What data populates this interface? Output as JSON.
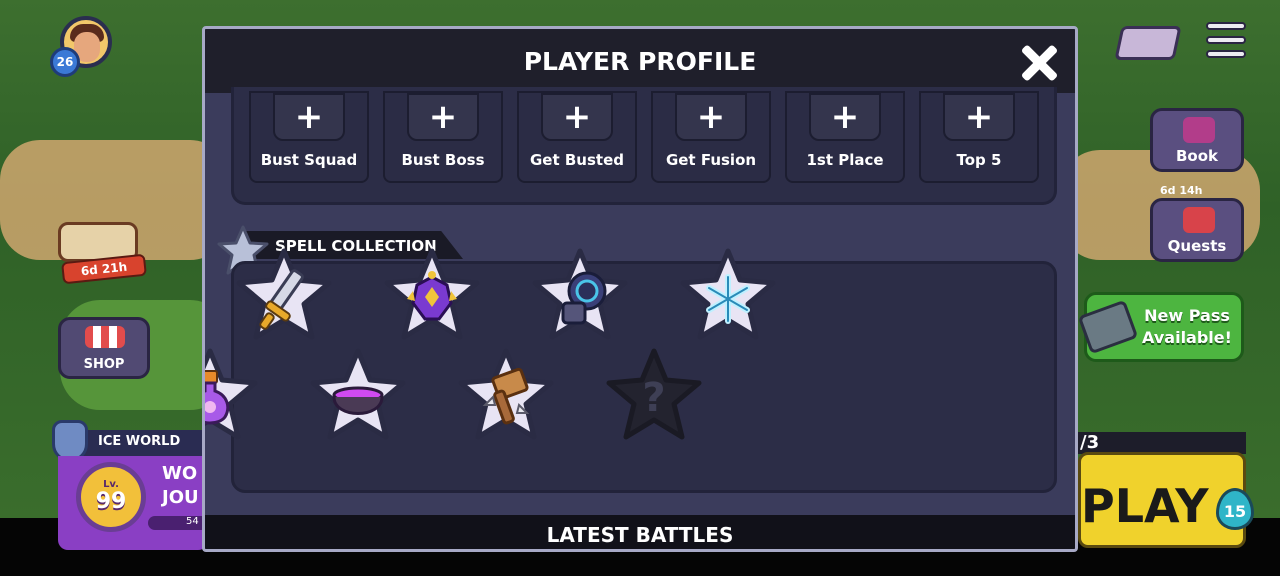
{
  "hud": {
    "player_level": "26",
    "event_timer": "6d 21h",
    "shop_label": "SHOP",
    "world_name": "ICE WORLD",
    "world_level_prefix": "Lv.",
    "world_level": "99",
    "world_title_line1": "WO",
    "world_title_line2": "JOU",
    "world_xp_text": "54",
    "book_label": "Book",
    "quests_timer": "6d 14h",
    "quests_label": "Quests",
    "pass_label": "New Pass Available!",
    "play_progress": "/3",
    "play_label": "PLAY",
    "energy_count": "15"
  },
  "modal": {
    "title": "PLAYER PROFILE",
    "achievements": [
      {
        "label": "Bust Squad",
        "icon": "plus-icon"
      },
      {
        "label": "Bust Boss",
        "icon": "plus-icon"
      },
      {
        "label": "Get Busted",
        "icon": "plus-icon"
      },
      {
        "label": "Get Fusion",
        "icon": "plus-icon"
      },
      {
        "label": "1st Place",
        "icon": "plus-icon"
      },
      {
        "label": "Top 5",
        "icon": "plus-icon"
      }
    ],
    "achievement_plus": "+",
    "spell_collection_title": "SPELL COLLECTION",
    "spells": [
      {
        "icon": "heart-heal-icon",
        "unlocked": true
      },
      {
        "icon": "sword-icon",
        "unlocked": true
      },
      {
        "icon": "spiked-bomb-icon",
        "unlocked": true
      },
      {
        "icon": "cannon-icon",
        "unlocked": true
      },
      {
        "icon": "snowflake-icon",
        "unlocked": true
      },
      {
        "icon": "potion-icon",
        "unlocked": true
      },
      {
        "icon": "cauldron-icon",
        "unlocked": true
      },
      {
        "icon": "spiked-hammer-icon",
        "unlocked": true
      },
      {
        "icon": "locked-question-icon",
        "unlocked": false
      }
    ],
    "locked_symbol": "?",
    "latest_battles_title": "LATEST BATTLES"
  },
  "colors": {
    "modal_bg": "#3b3c5c",
    "header_bg": "#1f1f2b",
    "star_unlocked": "#e8e4f4",
    "star_locked": "#23232f",
    "pass_green": "#4db540",
    "play_yellow": "#f0d22c"
  }
}
